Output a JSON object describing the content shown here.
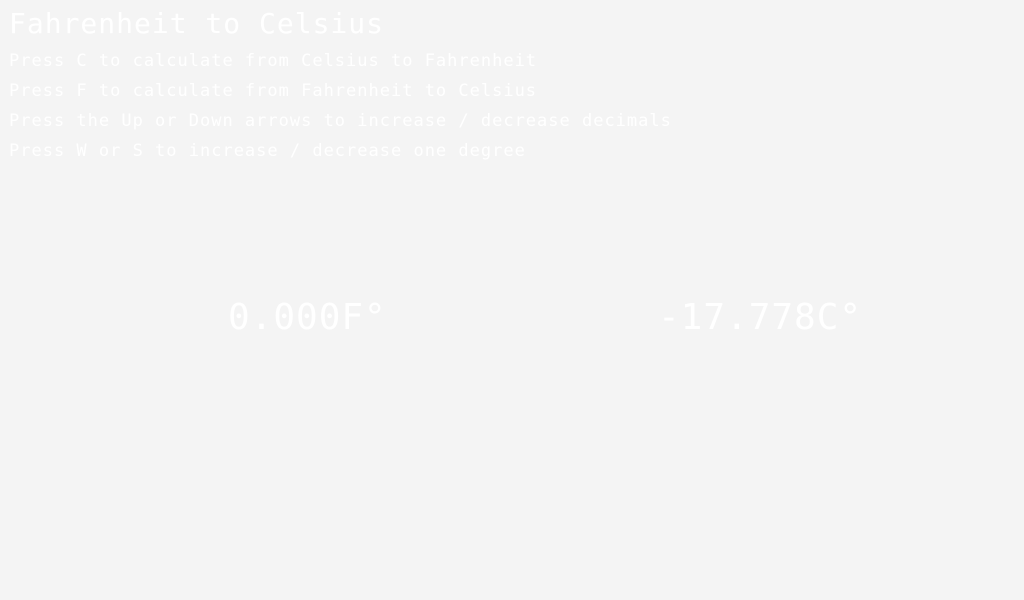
{
  "title": "Fahrenheit to Celsius",
  "instructions": [
    "Press C to calculate from Celsius to Fahrenheit",
    "Press F to calculate from Fahrenheit to Celsius",
    "Press the Up or Down arrows to increase / decrease decimals",
    "Press W or S to increase / decrease one degree"
  ],
  "readings": {
    "fahrenheit": "0.000F°",
    "celsius": "-17.778C°"
  },
  "colors": {
    "background": "#f4f4f4",
    "text": "#ffffff"
  }
}
